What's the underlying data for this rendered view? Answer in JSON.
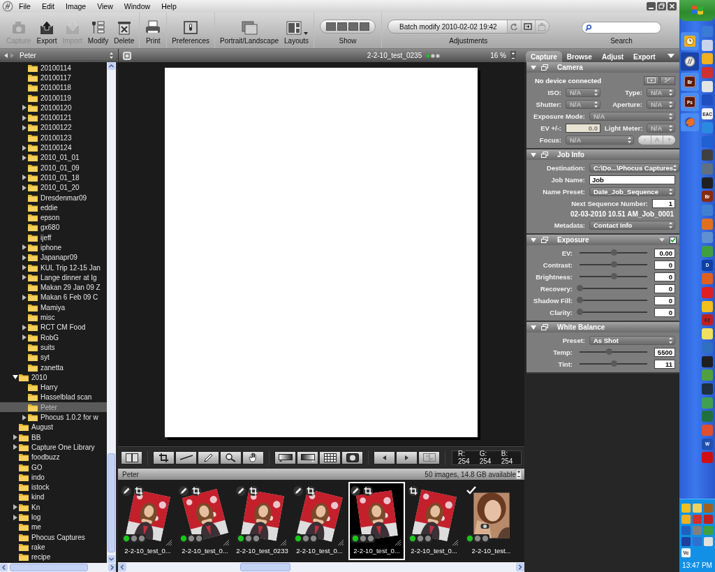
{
  "menu": [
    "File",
    "Edit",
    "Image",
    "View",
    "Window",
    "Help"
  ],
  "toolbar": {
    "groups": [
      [
        {
          "label": "Capture",
          "kind": "camera",
          "disabled": true
        },
        {
          "label": "Export",
          "kind": "export",
          "disabled": false
        },
        {
          "label": "Import",
          "kind": "import",
          "disabled": true
        },
        {
          "label": "Modify",
          "kind": "modify",
          "disabled": false
        },
        {
          "label": "Delete",
          "kind": "delete",
          "disabled": false
        }
      ],
      [
        {
          "label": "Print",
          "kind": "print",
          "disabled": false
        }
      ],
      [
        {
          "label": "Preferences",
          "kind": "preferences",
          "disabled": false
        }
      ],
      [
        {
          "label": "Portrait/Landscape",
          "kind": "orientation",
          "disabled": false
        },
        {
          "label": "Layouts",
          "kind": "layouts",
          "disabled": false
        }
      ]
    ],
    "show": {
      "label": "Show"
    },
    "adjustments": {
      "batch": "Batch modify 2010-02-02 19:42",
      "label": "Adjustments"
    },
    "search": {
      "label": "Search"
    }
  },
  "view_bar": {
    "folder": "Peter",
    "image_name": "2-2-10_test_0235",
    "zoom": "16 %",
    "tabs": [
      {
        "label": "Capture",
        "selected": true
      },
      {
        "label": "Browse",
        "selected": false
      },
      {
        "label": "Adjust",
        "selected": false
      },
      {
        "label": "Export",
        "selected": false
      }
    ]
  },
  "tree": {
    "continued": [
      {
        "label": "20100114",
        "has_children": false,
        "selected": false
      },
      {
        "label": "20100117",
        "has_children": false,
        "selected": false
      },
      {
        "label": "20100118",
        "has_children": false,
        "selected": false
      },
      {
        "label": "20100119",
        "has_children": false,
        "selected": false
      },
      {
        "label": "20100120",
        "has_children": true,
        "expanded": false,
        "selected": false
      },
      {
        "label": "20100121",
        "has_children": true,
        "expanded": false,
        "selected": false
      },
      {
        "label": "20100122",
        "has_children": true,
        "expanded": false,
        "selected": false
      },
      {
        "label": "20100123",
        "has_children": false,
        "selected": false
      },
      {
        "label": "20100124",
        "has_children": true,
        "expanded": false,
        "selected": false
      },
      {
        "label": "2010_01_01",
        "has_children": true,
        "expanded": false,
        "selected": false
      },
      {
        "label": "2010_01_09",
        "has_children": false,
        "selected": false
      },
      {
        "label": "2010_01_18",
        "has_children": true,
        "expanded": false,
        "selected": false
      },
      {
        "label": "2010_01_20",
        "has_children": true,
        "expanded": false,
        "selected": false
      },
      {
        "label": "Dresdenmar09",
        "has_children": false,
        "selected": false
      },
      {
        "label": "eddie",
        "has_children": false,
        "selected": false
      },
      {
        "label": "epson",
        "has_children": false,
        "selected": false
      },
      {
        "label": "gx680",
        "has_children": false,
        "selected": false
      },
      {
        "label": "ijeff",
        "has_children": false,
        "selected": false
      },
      {
        "label": "iphone",
        "has_children": true,
        "expanded": false,
        "selected": false
      },
      {
        "label": "Japanapr09",
        "has_children": true,
        "expanded": false,
        "selected": false
      },
      {
        "label": "KUL Trip 12-15 Jan",
        "has_children": true,
        "expanded": false,
        "selected": false
      },
      {
        "label": "Lange dinner at Ig",
        "has_children": true,
        "expanded": false,
        "selected": false
      },
      {
        "label": "Makan 29 Jan 09 Z",
        "has_children": false,
        "selected": false
      },
      {
        "label": "Makan 6 Feb 09 C",
        "has_children": true,
        "expanded": false,
        "selected": false
      },
      {
        "label": "Mamiya",
        "has_children": false,
        "selected": false
      },
      {
        "label": "misc",
        "has_children": false,
        "selected": false
      },
      {
        "label": "RCT CM Food",
        "has_children": true,
        "expanded": false,
        "selected": false
      },
      {
        "label": "RobG",
        "has_children": true,
        "expanded": false,
        "selected": false
      },
      {
        "label": "suits",
        "has_children": false,
        "selected": false
      },
      {
        "label": "syt",
        "has_children": false,
        "selected": false
      },
      {
        "label": "zanetta",
        "has_children": false,
        "selected": false
      }
    ],
    "items": [
      {
        "label": "2010",
        "has_children": true,
        "expanded": true,
        "selected": false,
        "children": [
          {
            "label": "Harry",
            "has_children": false,
            "selected": false
          },
          {
            "label": "Hasselblad scan",
            "has_children": false,
            "selected": false
          },
          {
            "label": "Peter",
            "has_children": false,
            "selected": true
          },
          {
            "label": "Phocus 1.0.2 for w",
            "has_children": true,
            "expanded": false,
            "selected": false
          }
        ]
      },
      {
        "label": "August",
        "has_children": false,
        "selected": false
      },
      {
        "label": "BB",
        "has_children": true,
        "expanded": false,
        "selected": false
      },
      {
        "label": "Capture One Library",
        "has_children": true,
        "expanded": false,
        "selected": false
      },
      {
        "label": "foodbuzz",
        "has_children": false,
        "selected": false
      },
      {
        "label": "GO",
        "has_children": false,
        "selected": false
      },
      {
        "label": "indo",
        "has_children": false,
        "selected": false
      },
      {
        "label": "istock",
        "has_children": false,
        "selected": false
      },
      {
        "label": "kind",
        "has_children": false,
        "selected": false
      },
      {
        "label": "Kn",
        "has_children": true,
        "expanded": false,
        "selected": false
      },
      {
        "label": "log",
        "has_children": true,
        "expanded": false,
        "selected": false
      },
      {
        "label": "me",
        "has_children": false,
        "selected": false
      },
      {
        "label": "Phocus Captures",
        "has_children": false,
        "selected": false
      },
      {
        "label": "rake",
        "has_children": false,
        "selected": false
      },
      {
        "label": "recipe",
        "has_children": false,
        "selected": false
      }
    ]
  },
  "readout": [
    "R: 254",
    "G: 254",
    "B: 254"
  ],
  "filmstrip": {
    "folder": "Peter",
    "info": "50  images, 14.8 GB available",
    "thumbnails": [
      {
        "caption": "2-2-10_test_0...",
        "selected": false,
        "pencil": true,
        "crop": true,
        "check": false
      },
      {
        "caption": "2-2-10_test_0...",
        "selected": false,
        "pencil": true,
        "crop": true,
        "check": false
      },
      {
        "caption": "2-2-10_test_0233",
        "selected": false,
        "pencil": true,
        "crop": true,
        "check": false
      },
      {
        "caption": "2-2-10_test_0...",
        "selected": false,
        "pencil": true,
        "crop": true,
        "check": false
      },
      {
        "caption": "2-2-10_test_0...",
        "selected": true,
        "pencil": true,
        "crop": true,
        "check": false
      },
      {
        "caption": "2-2-10_test_0...",
        "selected": false,
        "pencil": false,
        "crop": true,
        "check": false
      },
      {
        "caption": "2-2-10_test...",
        "selected": false,
        "pencil": false,
        "crop": false,
        "check": true
      }
    ]
  },
  "panel": {
    "sections": [
      {
        "title": "Camera",
        "expanded": true,
        "rows": [
          {
            "kind": "status",
            "text": "No device connected"
          },
          {
            "kind": "pair",
            "fields": [
              {
                "kind": "select",
                "label": "ISO:",
                "value": "N/A",
                "disabled": true
              },
              {
                "kind": "select",
                "label": "Type:",
                "value": "N/A",
                "disabled": true
              }
            ]
          },
          {
            "kind": "pair",
            "fields": [
              {
                "kind": "select",
                "label": "Shutter:",
                "value": "N/A",
                "disabled": true
              },
              {
                "kind": "select",
                "label": "Aperture:",
                "value": "N/A",
                "disabled": true
              }
            ]
          },
          {
            "kind": "select",
            "label": "Exposure Mode:",
            "value": "N/A",
            "disabled": true
          },
          {
            "kind": "pair",
            "fields": [
              {
                "kind": "input",
                "label": "EV +/-:",
                "value": "0.0",
                "disabled": true
              },
              {
                "kind": "select",
                "label": "Light Meter:",
                "value": "N/A",
                "disabled": true
              }
            ]
          },
          {
            "kind": "focus",
            "label": "Focus:",
            "value": "N/A",
            "disabled": true,
            "buttons": [
              "-",
              "A",
              "+"
            ]
          }
        ]
      },
      {
        "title": "Job Info",
        "expanded": true,
        "rows": [
          {
            "kind": "select",
            "label": "Destination:",
            "value": "C:\\Do...\\Phocus Captures",
            "disabled": false
          },
          {
            "kind": "input",
            "label": "Job Name:",
            "value": "Job",
            "disabled": false
          },
          {
            "kind": "select",
            "label": "Name Preset:",
            "value": "Date_Job_Sequence",
            "disabled": false
          },
          {
            "kind": "number",
            "label": "Next Sequence Number:",
            "value": "1",
            "disabled": false
          },
          {
            "kind": "note",
            "text": "02-03-2010 10.51 AM_Job_0001"
          },
          {
            "kind": "select",
            "label": "Metadata:",
            "value": "Contact Info",
            "disabled": false
          }
        ]
      },
      {
        "title": "Exposure",
        "expanded": true,
        "checkbox": {
          "checked": true
        },
        "rows": [
          {
            "kind": "slider",
            "label": "EV:",
            "level": 0.5,
            "value": "0.00"
          },
          {
            "kind": "slider",
            "label": "Contrast:",
            "level": 0.5,
            "value": "0"
          },
          {
            "kind": "slider",
            "label": "Brightness:",
            "level": 0.5,
            "value": "0"
          },
          {
            "kind": "slider",
            "label": "Recovery:",
            "level": 0,
            "value": "0"
          },
          {
            "kind": "slider",
            "label": "Shadow Fill:",
            "level": 0,
            "value": "0"
          },
          {
            "kind": "slider",
            "label": "Clarity:",
            "level": 0,
            "value": "0"
          }
        ]
      },
      {
        "title": "White Balance",
        "expanded": true,
        "rows": [
          {
            "kind": "select",
            "label": "Preset:",
            "value": "As Shot",
            "disabled": false
          },
          {
            "kind": "slider",
            "label": "Temp:",
            "level": 0.43,
            "value": "5500"
          },
          {
            "kind": "slider",
            "label": "Tint:",
            "level": 0.5,
            "value": "11"
          }
        ]
      }
    ]
  },
  "taskbar": {
    "task_buttons": [
      {
        "kind": "clock",
        "selected": false
      },
      {
        "kind": "logo",
        "selected": true
      },
      {
        "kind": "letters",
        "label": "Br",
        "selected": false
      },
      {
        "kind": "letters",
        "label": "Ps",
        "selected": false
      },
      {
        "kind": "fox",
        "selected": false
      }
    ],
    "quick_launch": [
      {
        "color": "#3a7bd5"
      },
      {
        "color": "#c8d4ec"
      },
      {
        "color": "#f0b020"
      },
      {
        "color": "#d03030"
      },
      {
        "color": "#e4e4e4"
      },
      {
        "color": "#2050c0"
      },
      {
        "color": "#f4f4f4",
        "label": "EAC"
      },
      {
        "color": "#2a8ae0"
      },
      {
        "color": "#2060d0"
      },
      {
        "color": "#404040"
      },
      {
        "color": "#607080"
      },
      {
        "color": "#202020"
      },
      {
        "color": "#8a2a10",
        "label": "Br"
      },
      {
        "color": "#4080d0"
      },
      {
        "color": "#e07020"
      },
      {
        "color": "#6090d0"
      },
      {
        "color": "#40a040"
      },
      {
        "color": "#1040a0",
        "label": "D"
      },
      {
        "color": "#e06020"
      },
      {
        "color": "#e02020"
      },
      {
        "color": "#f0c020"
      },
      {
        "color": "#c02020",
        "label": "FZ"
      },
      {
        "color": "#f0e060"
      },
      {
        "color": "#3070c0"
      },
      {
        "color": "#202020"
      },
      {
        "color": "#50a040"
      },
      {
        "color": "#203040"
      },
      {
        "color": "#40a050"
      },
      {
        "color": "#207040"
      },
      {
        "color": "#e05030"
      },
      {
        "color": "#2050b0",
        "label": "W"
      },
      {
        "color": "#d01010"
      }
    ],
    "tray": [
      {
        "color": "#f0c020"
      },
      {
        "color": "#f0d060"
      },
      {
        "color": "#a06020"
      },
      {
        "color": "#f0b020"
      },
      {
        "color": "#d03030"
      },
      {
        "color": "#c02020"
      },
      {
        "color": "#2060c0"
      },
      {
        "color": "#808080"
      },
      {
        "color": "#40a040"
      },
      {
        "color": "#2040a0"
      },
      {
        "color": "#3070d0"
      },
      {
        "color": "#e0e0e0"
      },
      {
        "color": "#f4f4f4",
        "label": "Vc"
      }
    ],
    "clock": "13:47 PM"
  }
}
